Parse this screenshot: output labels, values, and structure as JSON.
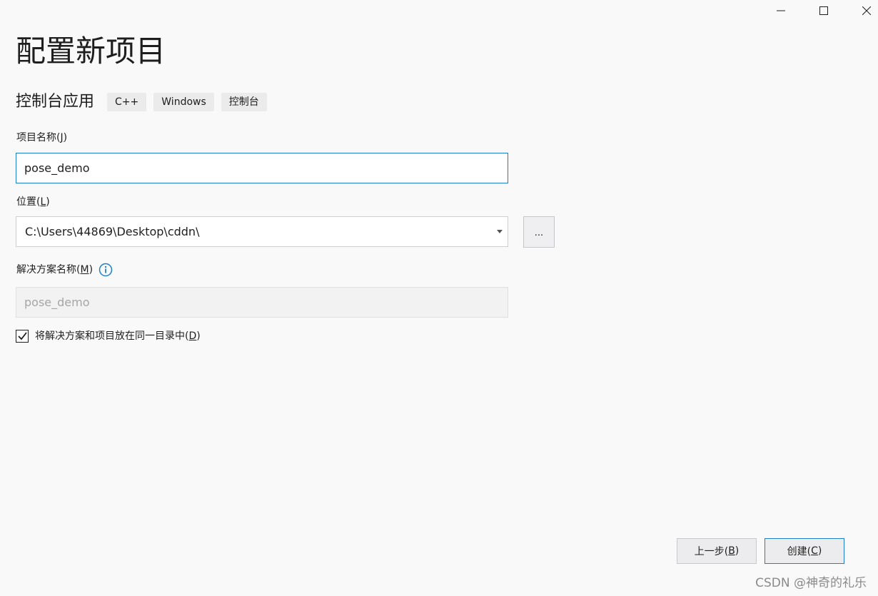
{
  "window": {
    "title": "配置新项目",
    "controls": [
      "minimize-icon",
      "maximize-icon",
      "close-icon"
    ]
  },
  "template": {
    "name": "控制台应用",
    "tags": [
      "C++",
      "Windows",
      "控制台"
    ]
  },
  "project_name": {
    "label": "项目名称(",
    "accel": "J",
    "label_end": ")",
    "value": "pose_demo"
  },
  "location": {
    "label": "位置(",
    "accel": "L",
    "label_end": ")",
    "value": "C:\\Users\\44869\\Desktop\\cddn\\",
    "browse_label": "..."
  },
  "solution_name": {
    "label": "解决方案名称(",
    "accel": "M",
    "label_end": ")",
    "placeholder": "pose_demo"
  },
  "same_directory": {
    "label": "将解决方案和项目放在同一目录中(",
    "accel": "D",
    "label_end": ")",
    "checked": true
  },
  "footer": {
    "back_label": "上一步(",
    "back_accel": "B",
    "back_end": ")",
    "create_label": "创建(",
    "create_accel": "C",
    "create_end": ")"
  },
  "watermark": "CSDN @神奇的礼乐",
  "colors": {
    "accent": "#1f80c8",
    "background": "#f9f9fa",
    "tag_background": "#ebebeb"
  }
}
